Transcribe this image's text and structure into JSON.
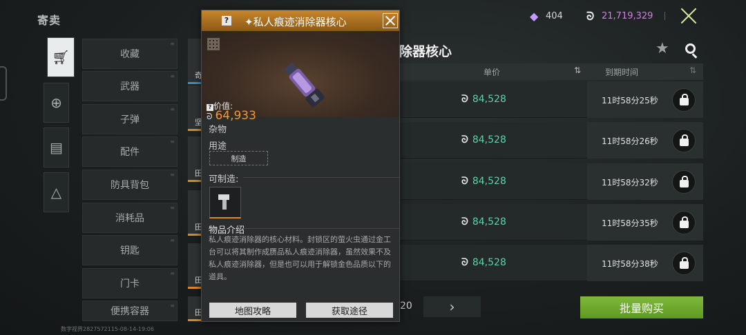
{
  "page": {
    "title": "寄卖"
  },
  "currency": {
    "gems": "404",
    "coins": "21,719,329",
    "gem_icon": "diamond-icon",
    "coin_icon": "coin-icon"
  },
  "left_tabs": [
    {
      "icon": "cart-icon",
      "active": true
    },
    {
      "icon": "cart-add-icon",
      "active": false
    },
    {
      "icon": "clipboard-icon",
      "active": false
    },
    {
      "icon": "triangle-logo-icon",
      "active": false
    }
  ],
  "categories": [
    "收藏",
    "武器",
    "子弹",
    "配件",
    "防具背包",
    "消耗品",
    "钥匙",
    "门卡",
    "便携容器"
  ],
  "item_strip": [
    "奇",
    "坚",
    "田",
    "田",
    "田",
    "田"
  ],
  "listing": {
    "title": "除器核心",
    "headers": {
      "price": "单价",
      "expiry": "到期时间"
    },
    "rows": [
      {
        "price": "84,528",
        "expiry": "11时58分25秒"
      },
      {
        "price": "84,528",
        "expiry": "11时58分26秒"
      },
      {
        "price": "84,528",
        "expiry": "11时58分32秒"
      },
      {
        "price": "84,528",
        "expiry": "11时58分35秒"
      },
      {
        "price": "84,528",
        "expiry": "11时58分38秒"
      }
    ],
    "page_number": "20",
    "bulk_buy": "批量购买"
  },
  "popup": {
    "help": "?",
    "title": "私人痕迹消除器核心",
    "value_label": "价值:",
    "value": "64,933",
    "type": "杂物",
    "use_label": "用途",
    "use_tag": "制造",
    "craftable_label": "可制造:",
    "desc_label": "物品介绍",
    "description": "私人痕迹消除器的核心材料。封锁区的萤火虫通过金工台可以将其制作成赝品私人痕迹消除器，虽然效果不及私人痕迹消除器，但是也可以用于解锁金色品质以下的道具。",
    "btn_map": "地图攻略",
    "btn_source": "获取途径"
  },
  "footer": {
    "id_text": "数字视界2827572115-08-14-19:06"
  },
  "colors": {
    "accent_green": "#5ed3a9",
    "value_orange": "#f09a2a",
    "coin_purple": "#d57fe6",
    "header_orange": "#c8862a"
  }
}
